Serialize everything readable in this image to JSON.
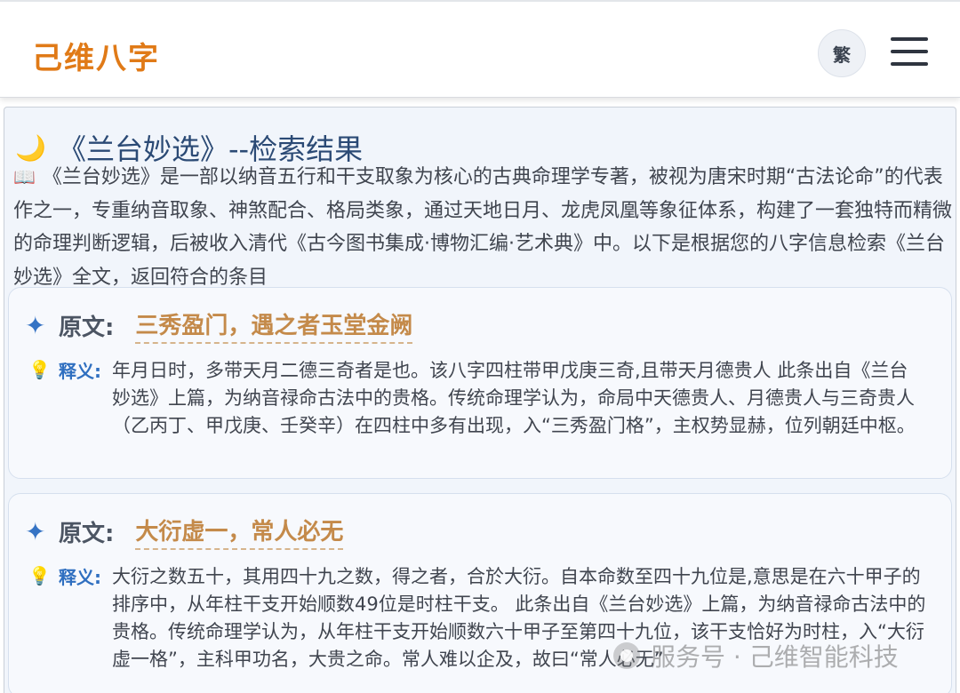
{
  "header": {
    "logo": "己维八字",
    "trad_label": "繁",
    "menu_icon": "hamburger-menu-icon"
  },
  "main": {
    "title_icon": "crescent-moon-icon",
    "title": "《兰台妙选》--检索结果",
    "intro_icon": "open-book-icon",
    "intro": "《兰台妙选》是一部以纳音五行和干支取象为核心的古典命理学专著，被视为唐宋时期“古法论命”的代表作之一，专重纳音取象、神煞配合、格局类象，通过天地日月、龙虎凤凰等象征体系，构建了一套独特而精微的命理判断逻辑，后被收入清代《古今图书集成·博物汇编·艺术典》中。以下是根据您的八字信息检索《兰台妙选》全文，返回符合的条目"
  },
  "results": [
    {
      "orig_label": "原文:",
      "orig_text": "三秀盈门，遇之者玉堂金阙",
      "expl_label": "释义:",
      "expl_text": "年月日时，多带天月二德三奇者是也。该八字四柱带甲戊庚三奇,且带天月德贵人 此条出自《兰台妙选》上篇，为纳音禄命古法中的贵格。传统命理学认为，命局中天德贵人、月德贵人与三奇贵人（乙丙丁、甲戊庚、壬癸辛）在四柱中多有出现，入“三秀盈门格”，主权势显赫，位列朝廷中枢。"
    },
    {
      "orig_label": "原文:",
      "orig_text": "大衍虚一，常人必无",
      "expl_label": "释义:",
      "expl_text": "大衍之数五十，其用四十九之数，得之者，合於大衍。自本命数至四十九位是,意思是在六十甲子的排序中，从年柱干支开始顺数49位是时柱干支。 此条出自《兰台妙选》上篇，为纳音禄命古法中的贵格。传统命理学认为，从年柱干支开始顺数六十甲子至第四十九位，该干支恰好为时柱，入“大衍虚一格”，主科甲功名，大贵之命。常人难以企及，故曰“常人必无”"
    }
  ],
  "watermark": "服务号 · 己维智能科技"
}
